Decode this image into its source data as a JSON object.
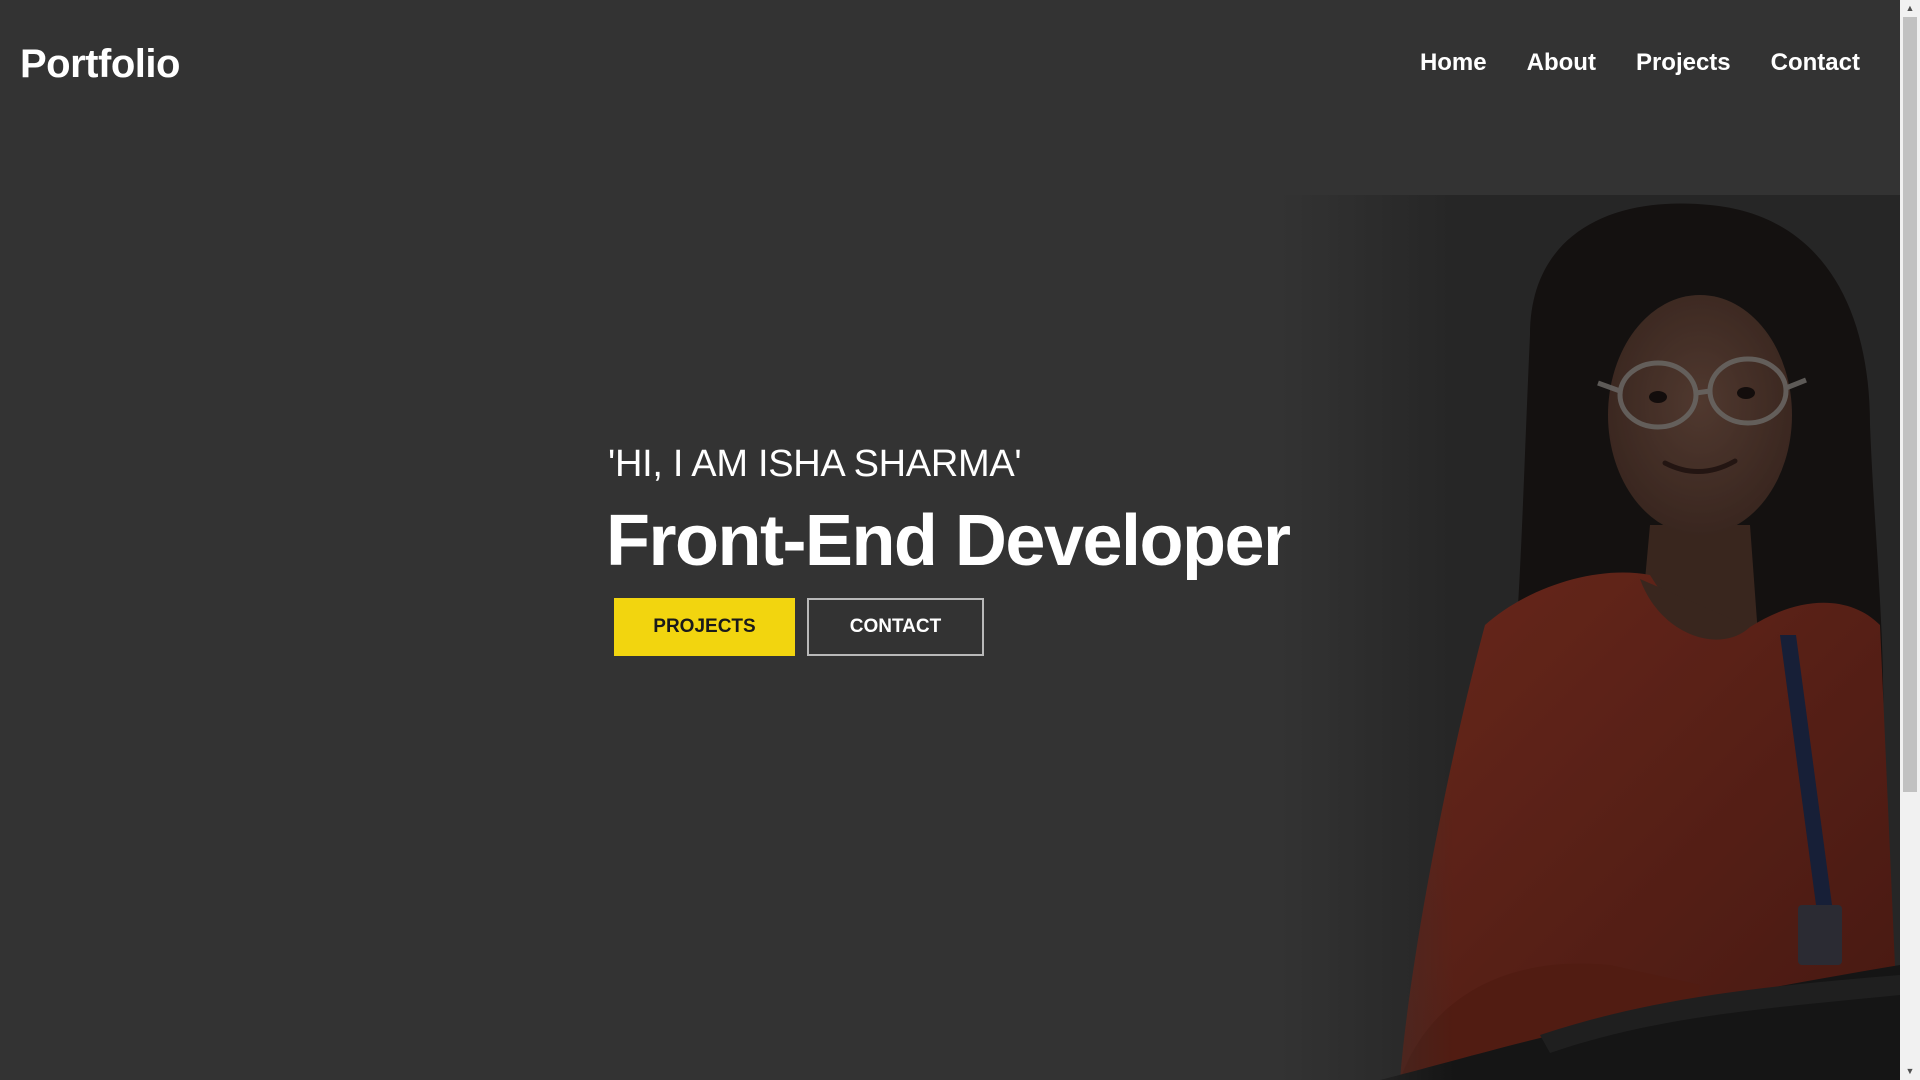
{
  "nav": {
    "logo": "Portfolio",
    "links": [
      "Home",
      "About",
      "Projects",
      "Contact"
    ]
  },
  "hero": {
    "greeting": "'HI, I AM ISHA SHARMA'",
    "role": "Front-End Developer",
    "primary_button": "PROJECTS",
    "secondary_button": "CONTACT"
  },
  "scrollbar": {
    "up_arrow": "▲",
    "down_arrow": "▼"
  },
  "colors": {
    "background": "#333333",
    "accent": "#f2d50f",
    "text": "#ffffff",
    "outline": "#b9b9b9"
  }
}
